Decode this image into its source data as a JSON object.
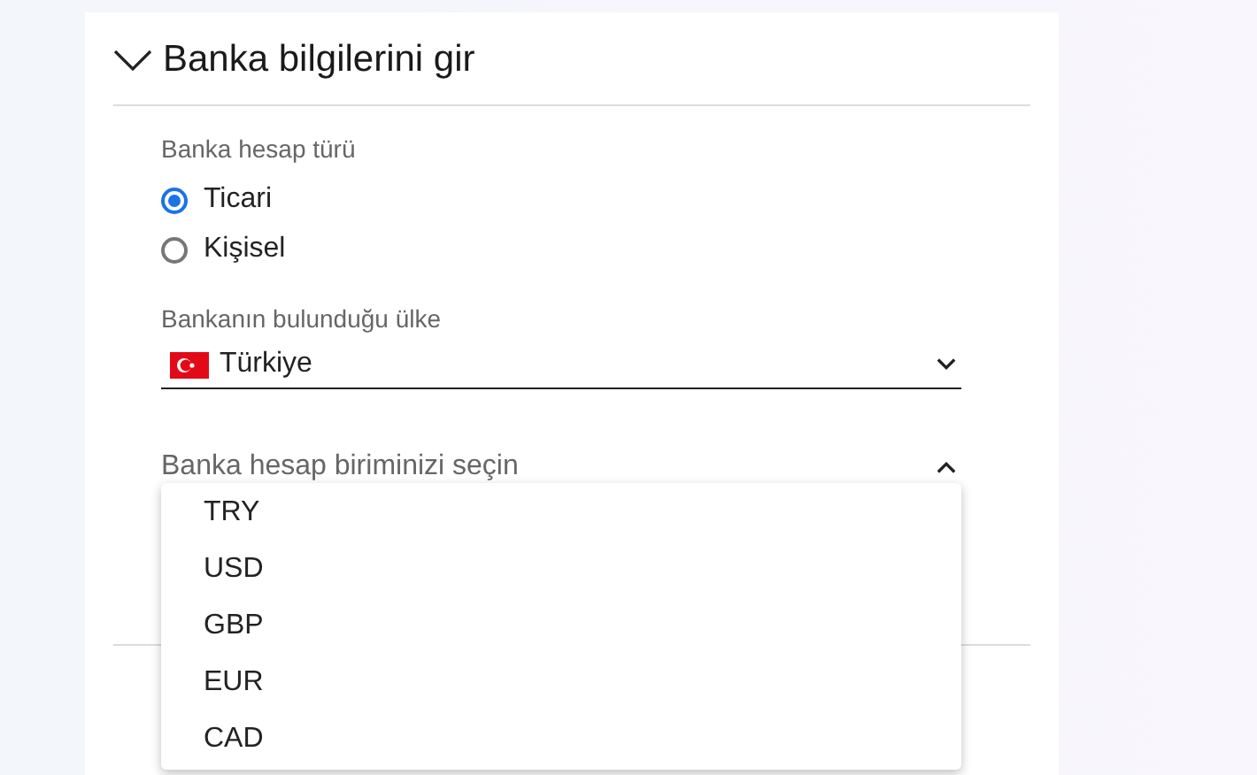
{
  "section": {
    "title": "Banka bilgilerini gir",
    "expanded": true
  },
  "account_type": {
    "label": "Banka hesap türü",
    "options": [
      {
        "label": "Ticari",
        "selected": true
      },
      {
        "label": "Kişisel",
        "selected": false
      }
    ]
  },
  "country": {
    "label": "Bankanın bulunduğu ülke",
    "value": "Türkiye"
  },
  "currency": {
    "placeholder": "Banka hesap biriminizi seçin",
    "expanded": true,
    "options": [
      "TRY",
      "USD",
      "GBP",
      "EUR",
      "CAD"
    ]
  }
}
